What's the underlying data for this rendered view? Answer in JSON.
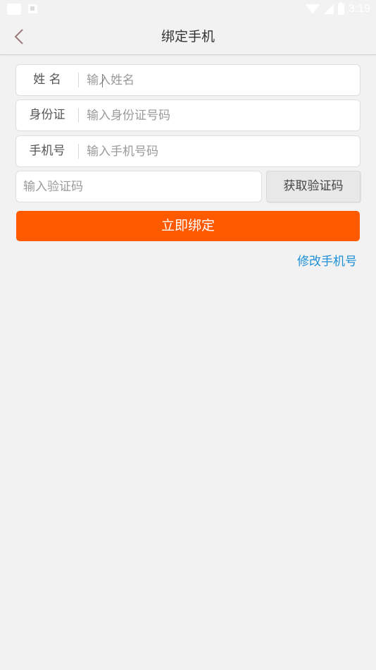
{
  "status_bar": {
    "time": "3:19"
  },
  "header": {
    "title": "绑定手机",
    "back_icon": "chevron-left-icon"
  },
  "form": {
    "name": {
      "label": "姓 名",
      "placeholder": "输入姓名",
      "value": ""
    },
    "id_card": {
      "label": "身份证",
      "placeholder": "输入身份证号码",
      "value": ""
    },
    "phone": {
      "label": "手机号",
      "placeholder": "输入手机号码",
      "value": ""
    },
    "code": {
      "placeholder": "输入验证码",
      "value": ""
    },
    "get_code_label": "获取验证码"
  },
  "actions": {
    "bind_label": "立即绑定",
    "change_phone_label": "修改手机号"
  },
  "colors": {
    "accent": "#ff5a00",
    "link": "#1e8fd6",
    "background": "#f2f2f2"
  }
}
